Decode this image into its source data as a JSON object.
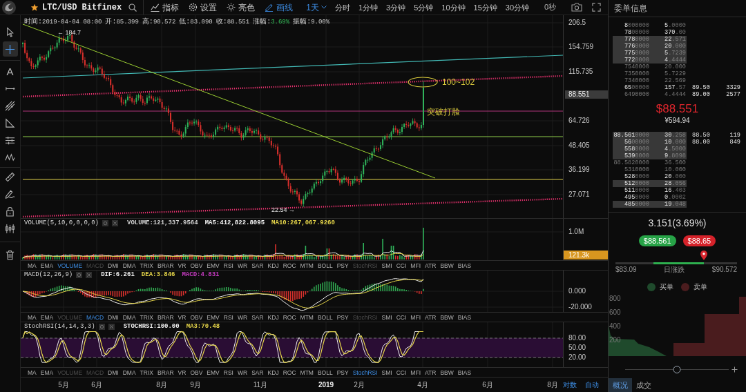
{
  "toolbar": {
    "pair": "LTC/USD Bitfinex",
    "favorite": true,
    "tools": [
      {
        "label": "指标",
        "active": false
      },
      {
        "label": "设置",
        "active": false
      },
      {
        "label": "亮色",
        "active": false
      },
      {
        "label": "画线",
        "active": true
      }
    ],
    "timeframes": [
      {
        "label": "1天",
        "selected": true
      },
      {
        "label": "分时",
        "selected": false
      },
      {
        "label": "1分钟",
        "selected": false
      },
      {
        "label": "3分钟",
        "selected": false
      },
      {
        "label": "5分钟",
        "selected": false
      },
      {
        "label": "10分钟",
        "selected": false
      },
      {
        "label": "15分钟",
        "selected": false
      },
      {
        "label": "30分钟",
        "selected": false
      }
    ],
    "countdown": "0秒"
  },
  "drawing_tools": [
    {
      "selected": false
    },
    {
      "selected": true
    },
    {
      "glyph": "A",
      "selected": false
    },
    {
      "selected": false
    },
    {
      "selected": false
    },
    {
      "selected": false
    },
    {
      "selected": false
    },
    {
      "selected": false
    },
    {
      "selected": false
    },
    {
      "selected": false
    },
    {
      "selected": false
    },
    {
      "selected": false
    },
    {
      "selected": false
    }
  ],
  "main_chart": {
    "info": [
      {
        "kind": "plain",
        "label": "时间:",
        "value": "2019-04-04 08:00"
      },
      {
        "kind": "plain",
        "label": "开:",
        "value": "85.399"
      },
      {
        "kind": "plain",
        "label": "高:",
        "value": "90.572"
      },
      {
        "kind": "plain",
        "label": "低:",
        "value": "83.090"
      },
      {
        "kind": "plain",
        "label": "收:",
        "value": "88.551"
      },
      {
        "kind": "change",
        "label": "涨幅:",
        "value": "3.69%"
      },
      {
        "kind": "plain",
        "label": "振幅:",
        "value": "9.00%"
      }
    ],
    "high_label": "← 184.7",
    "low_label": "22.54 →",
    "annotations": [
      {
        "kind": "ellipse",
        "text": "100~102"
      },
      {
        "kind": "label",
        "text": "突破打脸"
      }
    ],
    "price_ticks": [
      "206.5",
      "154.759",
      "115.735",
      "64.726",
      "48.405",
      "36.199",
      "27.071"
    ],
    "last_price": "88.551"
  },
  "panes": [
    {
      "kind": "volume",
      "title": "VOLUME(5,10,0,0,0,0)",
      "values": [
        {
          "text": "VOLUME:121,337.9564",
          "color": "#d0d0d0"
        },
        {
          "text": "MA5:412,822.8095",
          "color": "#f2f2f2"
        },
        {
          "text": "MA10:267,067.9260",
          "color": "#e6d64a"
        }
      ],
      "ticks": [
        "1.0M"
      ],
      "badge": "121.3k",
      "tabs": [
        {
          "label": "MA",
          "selected": false,
          "disabled": false
        },
        {
          "label": "EMA",
          "selected": false,
          "disabled": false
        },
        {
          "label": "VOLUME",
          "selected": true,
          "disabled": false
        },
        {
          "label": "MACD",
          "selected": false,
          "disabled": true
        },
        {
          "label": "DMI",
          "selected": false,
          "disabled": false
        },
        {
          "label": "DMA",
          "selected": false,
          "disabled": false
        },
        {
          "label": "TRIX",
          "selected": false,
          "disabled": false
        },
        {
          "label": "BRAR",
          "selected": false,
          "disabled": false
        },
        {
          "label": "VR",
          "selected": false,
          "disabled": false
        },
        {
          "label": "OBV",
          "selected": false,
          "disabled": false
        },
        {
          "label": "EMV",
          "selected": false,
          "disabled": false
        },
        {
          "label": "RSI",
          "selected": false,
          "disabled": false
        },
        {
          "label": "WR",
          "selected": false,
          "disabled": false
        },
        {
          "label": "SAR",
          "selected": false,
          "disabled": false
        },
        {
          "label": "KDJ",
          "selected": false,
          "disabled": false
        },
        {
          "label": "ROC",
          "selected": false,
          "disabled": false
        },
        {
          "label": "MTM",
          "selected": false,
          "disabled": false
        },
        {
          "label": "BOLL",
          "selected": false,
          "disabled": false
        },
        {
          "label": "PSY",
          "selected": false,
          "disabled": false
        },
        {
          "label": "StochRSI",
          "selected": false,
          "disabled": true
        },
        {
          "label": "SMI",
          "selected": false,
          "disabled": false
        },
        {
          "label": "CCI",
          "selected": false,
          "disabled": false
        },
        {
          "label": "MFI",
          "selected": false,
          "disabled": false
        },
        {
          "label": "ATR",
          "selected": false,
          "disabled": false
        },
        {
          "label": "BBW",
          "selected": false,
          "disabled": false
        },
        {
          "label": "BIAS",
          "selected": false,
          "disabled": false
        }
      ]
    },
    {
      "kind": "macd",
      "title": "MACD(12,26,9)",
      "values": [
        {
          "text": "DIF:6.261",
          "color": "#f2f2f2"
        },
        {
          "text": "DEA:3.846",
          "color": "#e6d64a"
        },
        {
          "text": "MACD:4.831",
          "color": "#c43bbf"
        }
      ],
      "ticks": [
        "0.000",
        "-20.000"
      ],
      "tabs": [
        {
          "label": "MA",
          "selected": false,
          "disabled": false
        },
        {
          "label": "EMA",
          "selected": false,
          "disabled": false
        },
        {
          "label": "VOLUME",
          "selected": false,
          "disabled": true
        },
        {
          "label": "MACD",
          "selected": true,
          "disabled": false
        },
        {
          "label": "DMI",
          "selected": false,
          "disabled": false
        },
        {
          "label": "DMA",
          "selected": false,
          "disabled": false
        },
        {
          "label": "TRIX",
          "selected": false,
          "disabled": false
        },
        {
          "label": "BRAR",
          "selected": false,
          "disabled": false
        },
        {
          "label": "VR",
          "selected": false,
          "disabled": false
        },
        {
          "label": "OBV",
          "selected": false,
          "disabled": false
        },
        {
          "label": "EMV",
          "selected": false,
          "disabled": false
        },
        {
          "label": "RSI",
          "selected": false,
          "disabled": false
        },
        {
          "label": "WR",
          "selected": false,
          "disabled": false
        },
        {
          "label": "SAR",
          "selected": false,
          "disabled": false
        },
        {
          "label": "KDJ",
          "selected": false,
          "disabled": false
        },
        {
          "label": "ROC",
          "selected": false,
          "disabled": false
        },
        {
          "label": "MTM",
          "selected": false,
          "disabled": false
        },
        {
          "label": "BOLL",
          "selected": false,
          "disabled": false
        },
        {
          "label": "PSY",
          "selected": false,
          "disabled": false
        },
        {
          "label": "StochRSI",
          "selected": false,
          "disabled": true
        },
        {
          "label": "SMI",
          "selected": false,
          "disabled": false
        },
        {
          "label": "CCI",
          "selected": false,
          "disabled": false
        },
        {
          "label": "MFI",
          "selected": false,
          "disabled": false
        },
        {
          "label": "ATR",
          "selected": false,
          "disabled": false
        },
        {
          "label": "BBW",
          "selected": false,
          "disabled": false
        },
        {
          "label": "BIAS",
          "selected": false,
          "disabled": false
        }
      ]
    },
    {
      "kind": "stochrsi",
      "title": "StochRSI(14,14,3,3)",
      "values": [
        {
          "text": "STOCHRSI:100.00",
          "color": "#f2f2f2"
        },
        {
          "text": "MA3:70.48",
          "color": "#e6d64a"
        }
      ],
      "ticks": [
        "80.00",
        "50.00",
        "20.00"
      ],
      "tabs": [
        {
          "label": "MA",
          "selected": false,
          "disabled": false
        },
        {
          "label": "EMA",
          "selected": false,
          "disabled": false
        },
        {
          "label": "VOLUME",
          "selected": false,
          "disabled": true
        },
        {
          "label": "MACD",
          "selected": false,
          "disabled": true
        },
        {
          "label": "DMI",
          "selected": false,
          "disabled": false
        },
        {
          "label": "DMA",
          "selected": false,
          "disabled": false
        },
        {
          "label": "TRIX",
          "selected": false,
          "disabled": false
        },
        {
          "label": "BRAR",
          "selected": false,
          "disabled": false
        },
        {
          "label": "VR",
          "selected": false,
          "disabled": false
        },
        {
          "label": "OBV",
          "selected": false,
          "disabled": false
        },
        {
          "label": "EMV",
          "selected": false,
          "disabled": false
        },
        {
          "label": "RSI",
          "selected": false,
          "disabled": false
        },
        {
          "label": "WR",
          "selected": false,
          "disabled": false
        },
        {
          "label": "SAR",
          "selected": false,
          "disabled": false
        },
        {
          "label": "KDJ",
          "selected": false,
          "disabled": false
        },
        {
          "label": "ROC",
          "selected": false,
          "disabled": false
        },
        {
          "label": "MTM",
          "selected": false,
          "disabled": false
        },
        {
          "label": "BOLL",
          "selected": false,
          "disabled": false
        },
        {
          "label": "PSY",
          "selected": false,
          "disabled": false
        },
        {
          "label": "StochRSI",
          "selected": true,
          "disabled": false
        },
        {
          "label": "SMI",
          "selected": false,
          "disabled": false
        },
        {
          "label": "CCI",
          "selected": false,
          "disabled": false
        },
        {
          "label": "MFI",
          "selected": false,
          "disabled": false
        },
        {
          "label": "ATR",
          "selected": false,
          "disabled": false
        },
        {
          "label": "BBW",
          "selected": false,
          "disabled": false
        },
        {
          "label": "BIAS",
          "selected": false,
          "disabled": false
        }
      ]
    }
  ],
  "time_axis": {
    "labels": [
      {
        "kind": "month",
        "text": "5月"
      },
      {
        "kind": "month",
        "text": "6月"
      },
      {
        "kind": "month",
        "text": "8月"
      },
      {
        "kind": "month",
        "text": "9月"
      },
      {
        "kind": "month",
        "text": "11月"
      },
      {
        "kind": "year",
        "text": "2019"
      },
      {
        "kind": "month",
        "text": "2月"
      },
      {
        "kind": "month",
        "text": "4月"
      },
      {
        "kind": "month",
        "text": "6月"
      },
      {
        "kind": "month",
        "text": "8月"
      }
    ],
    "buttons": [
      "对数",
      "自动"
    ]
  },
  "order_panel": {
    "title": "委单信息",
    "asks": [
      {
        "price": "8",
        "price_tail": "000000",
        "amount": "5",
        "amount_tail": ".0000",
        "highlighted": false,
        "faded": false
      },
      {
        "price": "78",
        "price_tail": "00000",
        "amount": "370",
        "amount_tail": ".00",
        "highlighted": false,
        "faded": false
      },
      {
        "price": "778",
        "price_tail": "0000",
        "amount": "22",
        "amount_tail": ".571",
        "highlighted": true,
        "faded": false
      },
      {
        "price": "776",
        "price_tail": "0000",
        "amount": "20",
        "amount_tail": ".000",
        "highlighted": true,
        "faded": false
      },
      {
        "price": "775",
        "price_tail": "0000",
        "amount": "5",
        "amount_tail": ".7239",
        "highlighted": true,
        "faded": false
      },
      {
        "price": "772",
        "price_tail": "0000",
        "amount": "4",
        "amount_tail": ".4444",
        "highlighted": true,
        "faded": false
      },
      {
        "price": "7540000",
        "amount": "20.000",
        "highlighted": false,
        "faded": true
      },
      {
        "price": "7350000",
        "amount": "5.7229",
        "highlighted": false,
        "faded": true
      },
      {
        "price": "7340000",
        "amount": "22.569",
        "highlighted": false,
        "faded": true
      },
      {
        "price": "65",
        "price_tail": "00000",
        "amount": "157",
        "amount_tail": ".57",
        "highlighted": false,
        "faded": false,
        "quote_price": "89.50",
        "quote_size": "3329"
      },
      {
        "price": "6490000",
        "amount": "4.4444",
        "highlighted": false,
        "faded": true,
        "quote_price": "89.00",
        "quote_size": "2577"
      }
    ],
    "price": "$88.551",
    "price_cny": "¥594.94",
    "bids": [
      {
        "price": "88.561",
        "price_tail": "0000",
        "amount": "30",
        "amount_tail": ".258",
        "highlighted": true,
        "faded": false,
        "quote_price": "88.50",
        "quote_size": "119"
      },
      {
        "price": "56",
        "price_tail": "00000",
        "amount": "10",
        "amount_tail": ".000",
        "highlighted": true,
        "faded": false,
        "quote_price": "88.00",
        "quote_size": "849"
      },
      {
        "price": "558",
        "price_tail": "0000",
        "amount": "4",
        "amount_tail": ".5000",
        "highlighted": true,
        "faded": false
      },
      {
        "price": "539",
        "price_tail": "0000",
        "amount": "9",
        "amount_tail": ".8098",
        "highlighted": true,
        "faded": false
      },
      {
        "price": "88.5820000",
        "amount": "36.500",
        "highlighted": false,
        "faded": true
      },
      {
        "price": "5310000",
        "amount": "10.000",
        "highlighted": false,
        "faded": true
      },
      {
        "price": "528",
        "price_tail": "0000",
        "amount": "20",
        "amount_tail": ".000",
        "highlighted": false,
        "faded": false
      },
      {
        "price": "512",
        "price_tail": "0000",
        "amount": "28",
        "amount_tail": ".056",
        "highlighted": true,
        "faded": false
      },
      {
        "price": "511",
        "price_tail": "0000",
        "amount": "16",
        "amount_tail": ".403",
        "highlighted": false,
        "faded": false
      },
      {
        "price": "495",
        "price_tail": "0000",
        "amount": "0",
        "amount_tail": ".0002",
        "highlighted": false,
        "faded": false
      },
      {
        "price": "485",
        "price_tail": "0000",
        "amount": "19",
        "amount_tail": ".048",
        "highlighted": true,
        "faded": false
      }
    ],
    "change": "3.151(3.69%)",
    "buy_price": "$88.561",
    "sell_price": "$88.65",
    "day_range": {
      "low": "$83.09",
      "label": "日涨跌",
      "high": "$90.572",
      "level": 0.73,
      "open": {
        "level": 0.31
      }
    },
    "legend": [
      {
        "label": "买单",
        "color": "#1f4a2c"
      },
      {
        "label": "卖单",
        "color": "#4a1c1e"
      }
    ],
    "depth_ticks": [
      "800",
      "600",
      "400",
      "200"
    ],
    "zoom": {
      "level": 0.5
    },
    "tabs": [
      {
        "label": "概况",
        "selected": true
      },
      {
        "label": "成交",
        "selected": false
      }
    ]
  }
}
